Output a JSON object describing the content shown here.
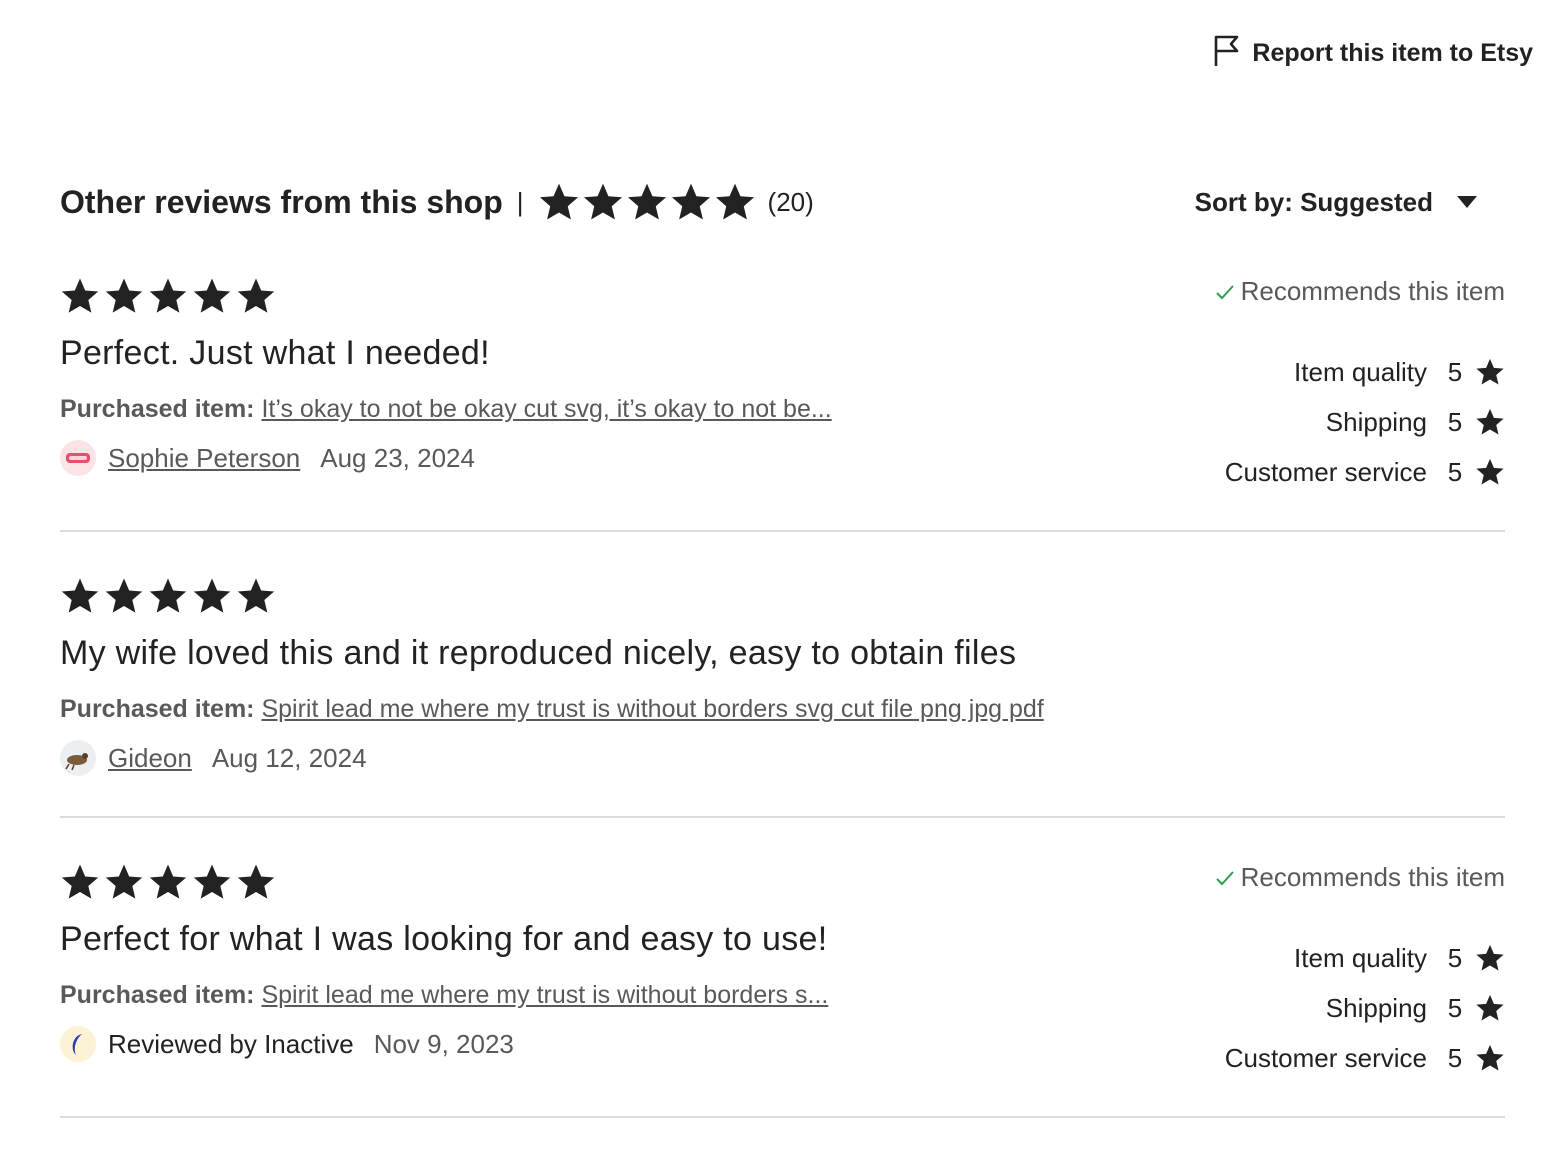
{
  "report": {
    "label": "Report this item to Etsy",
    "icon": "flag-icon"
  },
  "header": {
    "title": "Other reviews from this shop",
    "separator": "|",
    "rating": 5,
    "count": "(20)",
    "sort_label": "Sort by: Suggested"
  },
  "reviews": [
    {
      "rating": 5,
      "text": "Perfect. Just what I needed!",
      "purchased_label": "Purchased item:",
      "purchased_item": "It’s okay to not be okay cut svg, it’s okay to not be...",
      "reviewer": "Sophie Peterson",
      "date": "Aug 23, 2024",
      "recommends": "Recommends this item",
      "subratings": [
        {
          "label": "Item quality",
          "value": "5"
        },
        {
          "label": "Shipping",
          "value": "5"
        },
        {
          "label": "Customer service",
          "value": "5"
        }
      ]
    },
    {
      "rating": 5,
      "text": "My wife loved this and it reproduced nicely, easy to obtain files",
      "purchased_label": "Purchased item:",
      "purchased_item": "Spirit lead me where my trust is without borders svg cut file png jpg pdf",
      "reviewer": "Gideon",
      "date": "Aug 12, 2024"
    },
    {
      "rating": 5,
      "text": "Perfect for what I was looking for and easy to use!",
      "purchased_label": "Purchased item:",
      "purchased_item": "Spirit lead me where my trust is without borders s...",
      "reviewer": "Reviewed by Inactive",
      "date": "Nov 9, 2023",
      "recommends": "Recommends this item",
      "subratings": [
        {
          "label": "Item quality",
          "value": "5"
        },
        {
          "label": "Shipping",
          "value": "5"
        },
        {
          "label": "Customer service",
          "value": "5"
        }
      ]
    }
  ],
  "colors": {
    "text": "#222222",
    "muted": "#595959",
    "check": "#2e9e4f",
    "divider": "#dcdcdc"
  }
}
